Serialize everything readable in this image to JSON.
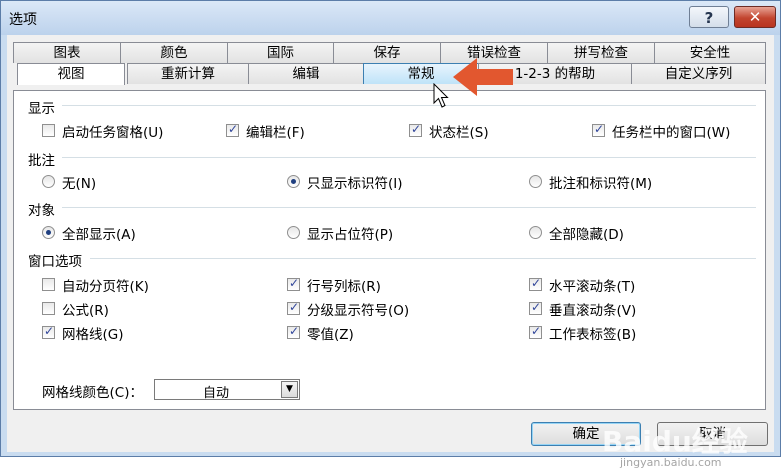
{
  "window": {
    "title": "选项",
    "help_label": "?",
    "close_label": "✕"
  },
  "tabs_row1": [
    "图表",
    "颜色",
    "国际",
    "保存",
    "错误检查",
    "拼写检查",
    "安全性"
  ],
  "tabs_row2": [
    "视图",
    "重新计算",
    "编辑",
    "常规",
    "1-2-3 的帮助",
    "自定义序列"
  ],
  "sections": {
    "display": {
      "title": "显示",
      "items": [
        "启动任务窗格(U)",
        "编辑栏(F)",
        "状态栏(S)",
        "任务栏中的窗口(W)"
      ],
      "checked": [
        false,
        true,
        true,
        true
      ]
    },
    "comments": {
      "title": "批注",
      "items": [
        "无(N)",
        "只显示标识符(I)",
        "批注和标识符(M)"
      ],
      "selected": 1
    },
    "objects": {
      "title": "对象",
      "items": [
        "全部显示(A)",
        "显示占位符(P)",
        "全部隐藏(D)"
      ],
      "selected": 0
    },
    "window_options": {
      "title": "窗口选项",
      "items": [
        "自动分页符(K)",
        "行号列标(R)",
        "水平滚动条(T)",
        "公式(R)",
        "分级显示符号(O)",
        "垂直滚动条(V)",
        "网格线(G)",
        "零值(Z)",
        "工作表标签(B)"
      ],
      "checked": [
        false,
        true,
        true,
        false,
        true,
        true,
        true,
        true,
        true
      ]
    },
    "gridline_color": {
      "label": "网格线颜色(C)：",
      "value": "自动"
    }
  },
  "buttons": {
    "ok": "确定",
    "cancel": "取消"
  },
  "watermark": {
    "brand": "Baidu经验",
    "url": "jingyan.baidu.com"
  },
  "colors": {
    "annotation_arrow": "#e2572f",
    "accent": "#3c7fb1"
  }
}
